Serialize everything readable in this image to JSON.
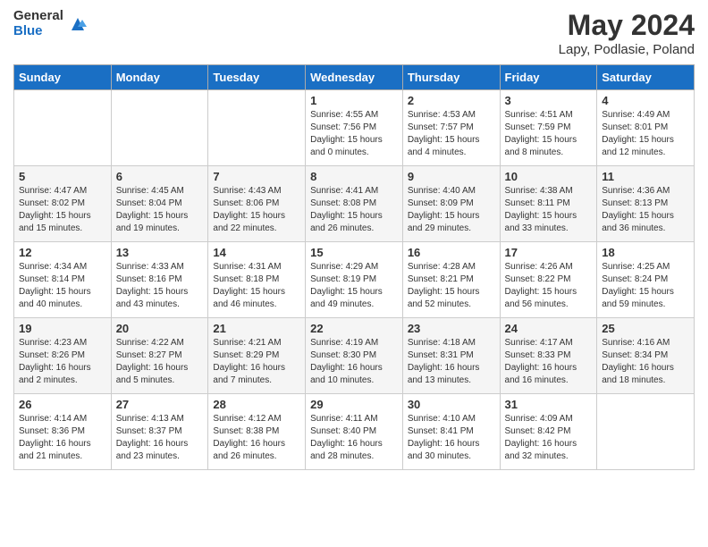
{
  "header": {
    "logo_general": "General",
    "logo_blue": "Blue",
    "month_year": "May 2024",
    "location": "Lapy, Podlasie, Poland"
  },
  "days_of_week": [
    "Sunday",
    "Monday",
    "Tuesday",
    "Wednesday",
    "Thursday",
    "Friday",
    "Saturday"
  ],
  "weeks": [
    [
      {
        "day": "",
        "info": ""
      },
      {
        "day": "",
        "info": ""
      },
      {
        "day": "",
        "info": ""
      },
      {
        "day": "1",
        "info": "Sunrise: 4:55 AM\nSunset: 7:56 PM\nDaylight: 15 hours\nand 0 minutes."
      },
      {
        "day": "2",
        "info": "Sunrise: 4:53 AM\nSunset: 7:57 PM\nDaylight: 15 hours\nand 4 minutes."
      },
      {
        "day": "3",
        "info": "Sunrise: 4:51 AM\nSunset: 7:59 PM\nDaylight: 15 hours\nand 8 minutes."
      },
      {
        "day": "4",
        "info": "Sunrise: 4:49 AM\nSunset: 8:01 PM\nDaylight: 15 hours\nand 12 minutes."
      }
    ],
    [
      {
        "day": "5",
        "info": "Sunrise: 4:47 AM\nSunset: 8:02 PM\nDaylight: 15 hours\nand 15 minutes."
      },
      {
        "day": "6",
        "info": "Sunrise: 4:45 AM\nSunset: 8:04 PM\nDaylight: 15 hours\nand 19 minutes."
      },
      {
        "day": "7",
        "info": "Sunrise: 4:43 AM\nSunset: 8:06 PM\nDaylight: 15 hours\nand 22 minutes."
      },
      {
        "day": "8",
        "info": "Sunrise: 4:41 AM\nSunset: 8:08 PM\nDaylight: 15 hours\nand 26 minutes."
      },
      {
        "day": "9",
        "info": "Sunrise: 4:40 AM\nSunset: 8:09 PM\nDaylight: 15 hours\nand 29 minutes."
      },
      {
        "day": "10",
        "info": "Sunrise: 4:38 AM\nSunset: 8:11 PM\nDaylight: 15 hours\nand 33 minutes."
      },
      {
        "day": "11",
        "info": "Sunrise: 4:36 AM\nSunset: 8:13 PM\nDaylight: 15 hours\nand 36 minutes."
      }
    ],
    [
      {
        "day": "12",
        "info": "Sunrise: 4:34 AM\nSunset: 8:14 PM\nDaylight: 15 hours\nand 40 minutes."
      },
      {
        "day": "13",
        "info": "Sunrise: 4:33 AM\nSunset: 8:16 PM\nDaylight: 15 hours\nand 43 minutes."
      },
      {
        "day": "14",
        "info": "Sunrise: 4:31 AM\nSunset: 8:18 PM\nDaylight: 15 hours\nand 46 minutes."
      },
      {
        "day": "15",
        "info": "Sunrise: 4:29 AM\nSunset: 8:19 PM\nDaylight: 15 hours\nand 49 minutes."
      },
      {
        "day": "16",
        "info": "Sunrise: 4:28 AM\nSunset: 8:21 PM\nDaylight: 15 hours\nand 52 minutes."
      },
      {
        "day": "17",
        "info": "Sunrise: 4:26 AM\nSunset: 8:22 PM\nDaylight: 15 hours\nand 56 minutes."
      },
      {
        "day": "18",
        "info": "Sunrise: 4:25 AM\nSunset: 8:24 PM\nDaylight: 15 hours\nand 59 minutes."
      }
    ],
    [
      {
        "day": "19",
        "info": "Sunrise: 4:23 AM\nSunset: 8:26 PM\nDaylight: 16 hours\nand 2 minutes."
      },
      {
        "day": "20",
        "info": "Sunrise: 4:22 AM\nSunset: 8:27 PM\nDaylight: 16 hours\nand 5 minutes."
      },
      {
        "day": "21",
        "info": "Sunrise: 4:21 AM\nSunset: 8:29 PM\nDaylight: 16 hours\nand 7 minutes."
      },
      {
        "day": "22",
        "info": "Sunrise: 4:19 AM\nSunset: 8:30 PM\nDaylight: 16 hours\nand 10 minutes."
      },
      {
        "day": "23",
        "info": "Sunrise: 4:18 AM\nSunset: 8:31 PM\nDaylight: 16 hours\nand 13 minutes."
      },
      {
        "day": "24",
        "info": "Sunrise: 4:17 AM\nSunset: 8:33 PM\nDaylight: 16 hours\nand 16 minutes."
      },
      {
        "day": "25",
        "info": "Sunrise: 4:16 AM\nSunset: 8:34 PM\nDaylight: 16 hours\nand 18 minutes."
      }
    ],
    [
      {
        "day": "26",
        "info": "Sunrise: 4:14 AM\nSunset: 8:36 PM\nDaylight: 16 hours\nand 21 minutes."
      },
      {
        "day": "27",
        "info": "Sunrise: 4:13 AM\nSunset: 8:37 PM\nDaylight: 16 hours\nand 23 minutes."
      },
      {
        "day": "28",
        "info": "Sunrise: 4:12 AM\nSunset: 8:38 PM\nDaylight: 16 hours\nand 26 minutes."
      },
      {
        "day": "29",
        "info": "Sunrise: 4:11 AM\nSunset: 8:40 PM\nDaylight: 16 hours\nand 28 minutes."
      },
      {
        "day": "30",
        "info": "Sunrise: 4:10 AM\nSunset: 8:41 PM\nDaylight: 16 hours\nand 30 minutes."
      },
      {
        "day": "31",
        "info": "Sunrise: 4:09 AM\nSunset: 8:42 PM\nDaylight: 16 hours\nand 32 minutes."
      },
      {
        "day": "",
        "info": ""
      }
    ]
  ]
}
